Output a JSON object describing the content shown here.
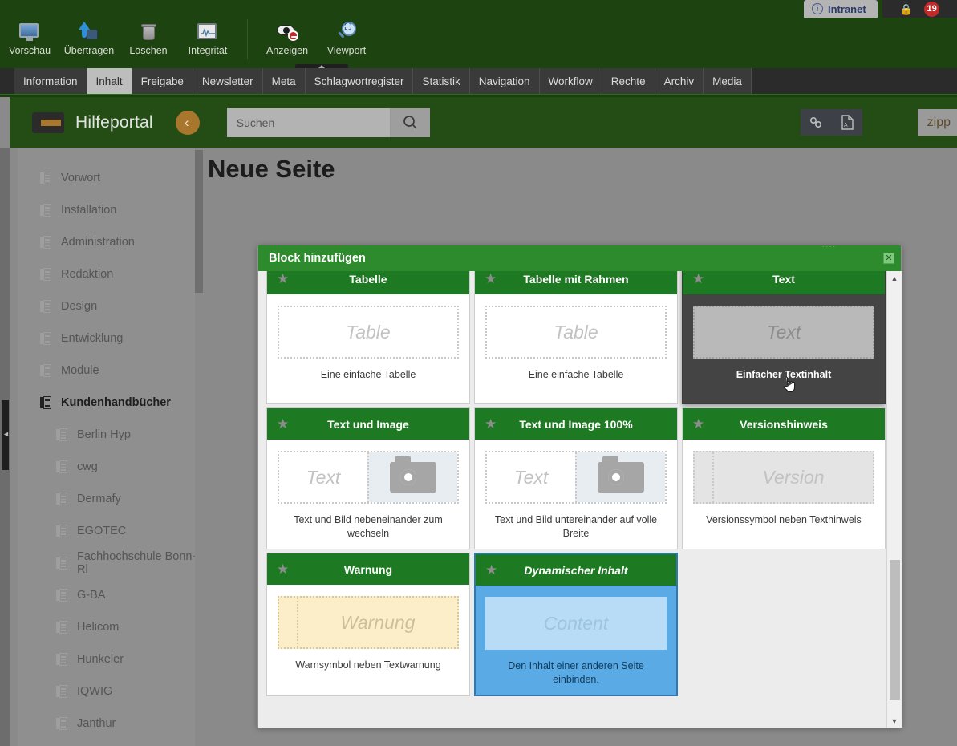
{
  "topbar": {
    "tab_label": "Intranet",
    "info_icon": "info-icon",
    "lock_icon": "lock-icon",
    "badge_count": "19"
  },
  "toolbar": {
    "items_left": [
      {
        "label": "Vorschau",
        "icon": "monitor-icon"
      },
      {
        "label": "Übertragen",
        "icon": "upload-icon"
      },
      {
        "label": "Löschen",
        "icon": "trash-icon"
      },
      {
        "label": "Integrität",
        "icon": "chart-monitor-icon"
      }
    ],
    "items_right": [
      {
        "label": "Anzeigen",
        "icon": "eye-deny-icon"
      },
      {
        "label": "Viewport",
        "icon": "viewport-magnifier-icon"
      }
    ]
  },
  "navtabs": {
    "items": [
      {
        "label": "Information",
        "active": false
      },
      {
        "label": "Inhalt",
        "active": true
      },
      {
        "label": "Freigabe",
        "active": false
      },
      {
        "label": "Newsletter",
        "active": false
      },
      {
        "label": "Meta",
        "active": false
      },
      {
        "label": "Schlagwortregister",
        "active": false
      },
      {
        "label": "Statistik",
        "active": false
      },
      {
        "label": "Navigation",
        "active": false
      },
      {
        "label": "Workflow",
        "active": false
      },
      {
        "label": "Rechte",
        "active": false
      },
      {
        "label": "Archiv",
        "active": false
      },
      {
        "label": "Media",
        "active": false
      }
    ]
  },
  "portal": {
    "logo_text": "Hilfeportal",
    "back_glyph": "‹",
    "search_placeholder": "Suchen",
    "search_value": "",
    "actions": [
      {
        "name": "link-icon"
      },
      {
        "name": "pdf-icon"
      }
    ],
    "zipp_label": "zipp"
  },
  "sidebar": {
    "items": [
      {
        "label": "Vorwort",
        "sub": false,
        "active": false
      },
      {
        "label": "Installation",
        "sub": false,
        "active": false
      },
      {
        "label": "Administration",
        "sub": false,
        "active": false
      },
      {
        "label": "Redaktion",
        "sub": false,
        "active": false
      },
      {
        "label": "Design",
        "sub": false,
        "active": false
      },
      {
        "label": "Entwicklung",
        "sub": false,
        "active": false
      },
      {
        "label": "Module",
        "sub": false,
        "active": false
      },
      {
        "label": "Kundenhandbücher",
        "sub": false,
        "active": true
      },
      {
        "label": "Berlin Hyp",
        "sub": true,
        "active": false
      },
      {
        "label": "cwg",
        "sub": true,
        "active": false
      },
      {
        "label": "Dermafy",
        "sub": true,
        "active": false
      },
      {
        "label": "EGOTEC",
        "sub": true,
        "active": false
      },
      {
        "label": "Fachhochschule Bonn-Rl",
        "sub": true,
        "active": false
      },
      {
        "label": "G-BA",
        "sub": true,
        "active": false
      },
      {
        "label": "Helicom",
        "sub": true,
        "active": false
      },
      {
        "label": "Hunkeler",
        "sub": true,
        "active": false
      },
      {
        "label": "IQWIG",
        "sub": true,
        "active": false
      },
      {
        "label": "Janthur",
        "sub": true,
        "active": false
      }
    ]
  },
  "content": {
    "page_title": "Neue Seite",
    "add_block_tooltip": "Block hinzufügen",
    "plus_icon": "plus-icon"
  },
  "modal": {
    "title": "Block hinzufügen",
    "close_label": "✕",
    "partial_cards": [
      {
        "state": "selected"
      },
      {
        "state": "normal"
      },
      {
        "state": "normal"
      }
    ],
    "cards": [
      {
        "title": "Tabelle",
        "preview_text": "Table",
        "desc": "Eine einfache Tabelle",
        "variant": "plain",
        "state": "normal",
        "star": "★"
      },
      {
        "title": "Tabelle mit Rahmen",
        "preview_text": "Table",
        "desc": "Eine einfache Tabelle",
        "variant": "plain",
        "state": "normal",
        "star": "★"
      },
      {
        "title": "Text",
        "preview_text": "Text",
        "desc": "Einfacher Textinhalt",
        "variant": "plain",
        "state": "hovered",
        "star": "★"
      },
      {
        "title": "Text und Image",
        "preview_text": "Text",
        "desc": "Text und Bild nebeneinander zum wechseln",
        "variant": "text-image",
        "state": "normal",
        "star": "★"
      },
      {
        "title": "Text und Image 100%",
        "preview_text": "Text",
        "desc": "Text und Bild untereinander auf volle Breite",
        "variant": "text-image",
        "state": "normal",
        "star": "★"
      },
      {
        "title": "Versionshinweis",
        "preview_text": "Version",
        "desc": "Versionssymbol neben Texthinweis",
        "variant": "version",
        "state": "normal",
        "star": "★"
      },
      {
        "title": "Warnung",
        "preview_text": "Warnung",
        "desc": "Warnsymbol neben Textwarnung",
        "variant": "warn",
        "state": "normal",
        "star": "★"
      },
      {
        "title": "Dynamischer Inhalt",
        "preview_text": "Content",
        "desc": "Den Inhalt einer anderen Seite einbinden.",
        "variant": "plain",
        "state": "selected",
        "star": "★"
      }
    ],
    "scroll_up": "▲",
    "scroll_down": "▼"
  },
  "colors": {
    "brand_green": "#1d4311",
    "modal_green": "#2d8a2d",
    "card_green": "#1e7a22",
    "accent_gold": "#a8762c",
    "selected_blue": "#5aaae6",
    "badge_red": "#c32b2b"
  }
}
